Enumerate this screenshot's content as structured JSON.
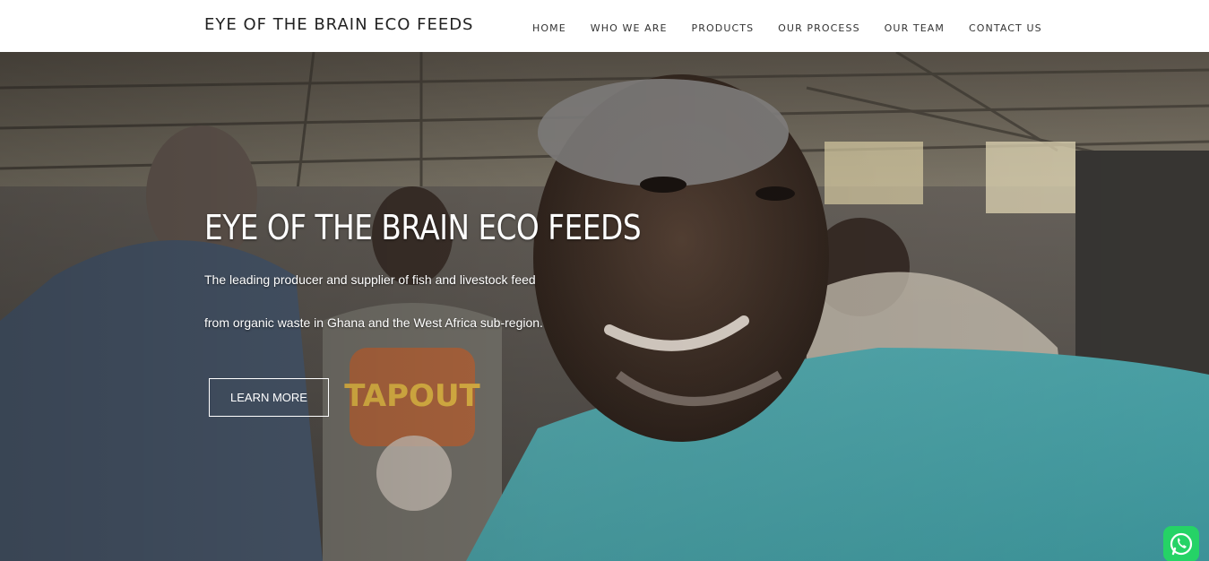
{
  "header": {
    "brand": "EYE OF THE BRAIN ECO FEEDS",
    "nav": [
      {
        "label": "HOME"
      },
      {
        "label": "WHO WE ARE"
      },
      {
        "label": "PRODUCTS"
      },
      {
        "label": "OUR PROCESS"
      },
      {
        "label": "OUR TEAM"
      },
      {
        "label": "CONTACT US"
      }
    ]
  },
  "hero": {
    "title": "EYE OF THE BRAIN ECO FEEDS",
    "line1": "The leading producer and supplier of fish and livestock feed",
    "line2": "from organic waste in Ghana and the West Africa sub-region.",
    "button": "LEARN MORE",
    "image": "hero-photo-workers-selfie",
    "shirt_text": "TAPOUT"
  },
  "floating": {
    "whatsapp_icon": "whatsapp-icon",
    "whatsapp_color": "#25d366"
  }
}
